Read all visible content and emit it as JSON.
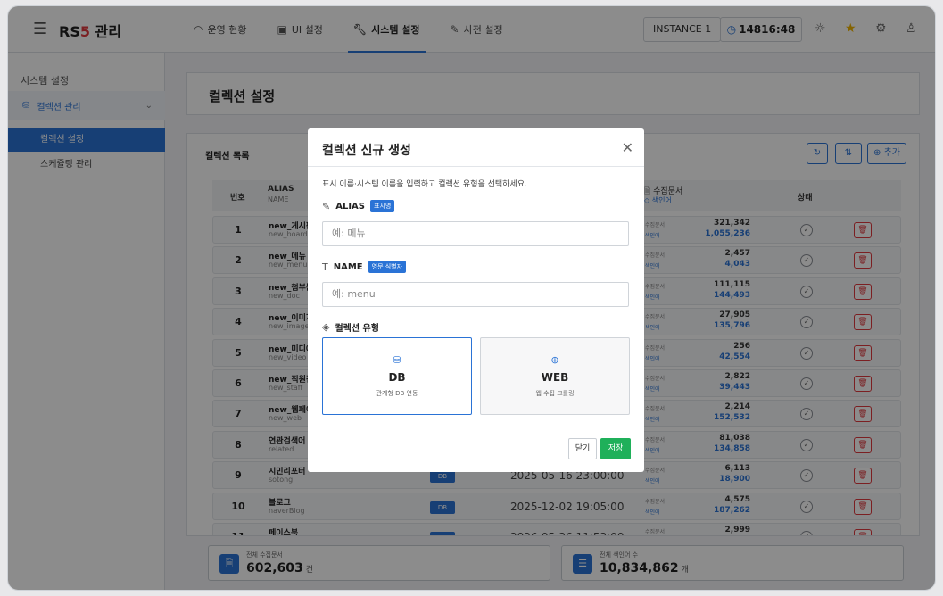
{
  "topbar": {
    "brand_prefix": "RS",
    "brand_accent": "5",
    "brand_suffix": " 관리",
    "nav": [
      {
        "label": "운영 현황",
        "icon": "gauge-icon"
      },
      {
        "label": "UI 설정",
        "icon": "layout-icon"
      },
      {
        "label": "시스템 설정",
        "icon": "wrench-icon",
        "active": true
      },
      {
        "label": "사전 설정",
        "icon": "edit-icon"
      }
    ],
    "instance_label": "INSTANCE 1",
    "clock": "14816:48"
  },
  "sidebar": {
    "title": "시스템 설정",
    "group_label": "컬렉션 관리",
    "items": [
      {
        "label": "컬렉션 설정",
        "active": true
      },
      {
        "label": "스케쥴링 관리",
        "active": false
      }
    ]
  },
  "page": {
    "title": "컬렉션 설정",
    "card_title": "컬렉션 목록",
    "add_label": "추가",
    "table_headers": {
      "num": "번호",
      "alias": "ALIAS",
      "name": "NAME",
      "docs": "수집문서",
      "index": "색인어",
      "status": "상태"
    },
    "row_labels": {
      "docs": "수집문서",
      "index": "색인어"
    },
    "rows": [
      {
        "num": "1",
        "alias": "new_게시판",
        "name": "new_board",
        "type": "",
        "date": "",
        "docs": "321,342",
        "index": "1,055,236"
      },
      {
        "num": "2",
        "alias": "new_메뉴",
        "name": "new_menu",
        "type": "",
        "date": "",
        "docs": "2,457",
        "index": "4,043"
      },
      {
        "num": "3",
        "alias": "new_첨부문",
        "name": "new_doc",
        "type": "",
        "date": "",
        "docs": "111,115",
        "index": "144,493"
      },
      {
        "num": "4",
        "alias": "new_이미지",
        "name": "new_image",
        "type": "",
        "date": "",
        "docs": "27,905",
        "index": "135,796"
      },
      {
        "num": "5",
        "alias": "new_미디어",
        "name": "new_video",
        "type": "",
        "date": "",
        "docs": "256",
        "index": "42,554"
      },
      {
        "num": "6",
        "alias": "new_직원검",
        "name": "new_staff",
        "type": "",
        "date": "",
        "docs": "2,822",
        "index": "39,443"
      },
      {
        "num": "7",
        "alias": "new_웹페이",
        "name": "new_web",
        "type": "",
        "date": "",
        "docs": "2,214",
        "index": "152,532"
      },
      {
        "num": "8",
        "alias": "연관검색어",
        "name": "related",
        "type": "",
        "date": "",
        "docs": "81,038",
        "index": "134,858"
      },
      {
        "num": "9",
        "alias": "시민리포터",
        "name": "sotong",
        "type": "DB",
        "date": "2025-05-16 23:00:00",
        "docs": "6,113",
        "index": "18,900"
      },
      {
        "num": "10",
        "alias": "블로그",
        "name": "naverBlog",
        "type": "DB",
        "date": "2025-12-02 19:05:00",
        "docs": "4,575",
        "index": "187,262"
      },
      {
        "num": "11",
        "alias": "페이스북",
        "name": "",
        "type": "DB",
        "date": "2026-05-26 11:53:00",
        "docs": "2,999",
        "index": ""
      }
    ],
    "stats": [
      {
        "label": "전체 수집문서",
        "value": "602,603",
        "unit": "건"
      },
      {
        "label": "전체 색인어 수",
        "value": "10,834,862",
        "unit": "개"
      }
    ]
  },
  "modal": {
    "title": "컬렉션 신규 생성",
    "description": "표시 이름·시스템 이름을 입력하고 컬렉션 유형을 선택하세요.",
    "alias_label": "ALIAS",
    "alias_tag": "표시명",
    "alias_placeholder": "예: 메뉴",
    "name_label": "NAME",
    "name_tag": "영문 식별자",
    "name_placeholder": "예: menu",
    "type_label": "컬렉션 유형",
    "types": [
      {
        "name": "DB",
        "desc": "관계형 DB 연동",
        "selected": true
      },
      {
        "name": "WEB",
        "desc": "웹 수집·크롤링",
        "selected": false
      }
    ],
    "close_label": "닫기",
    "save_label": "저장"
  },
  "colors": {
    "accent": "#2a73d6",
    "brand_red": "#e0393e",
    "save_green": "#1fb05a",
    "overlay": "rgba(0,0,0,0.45)"
  }
}
